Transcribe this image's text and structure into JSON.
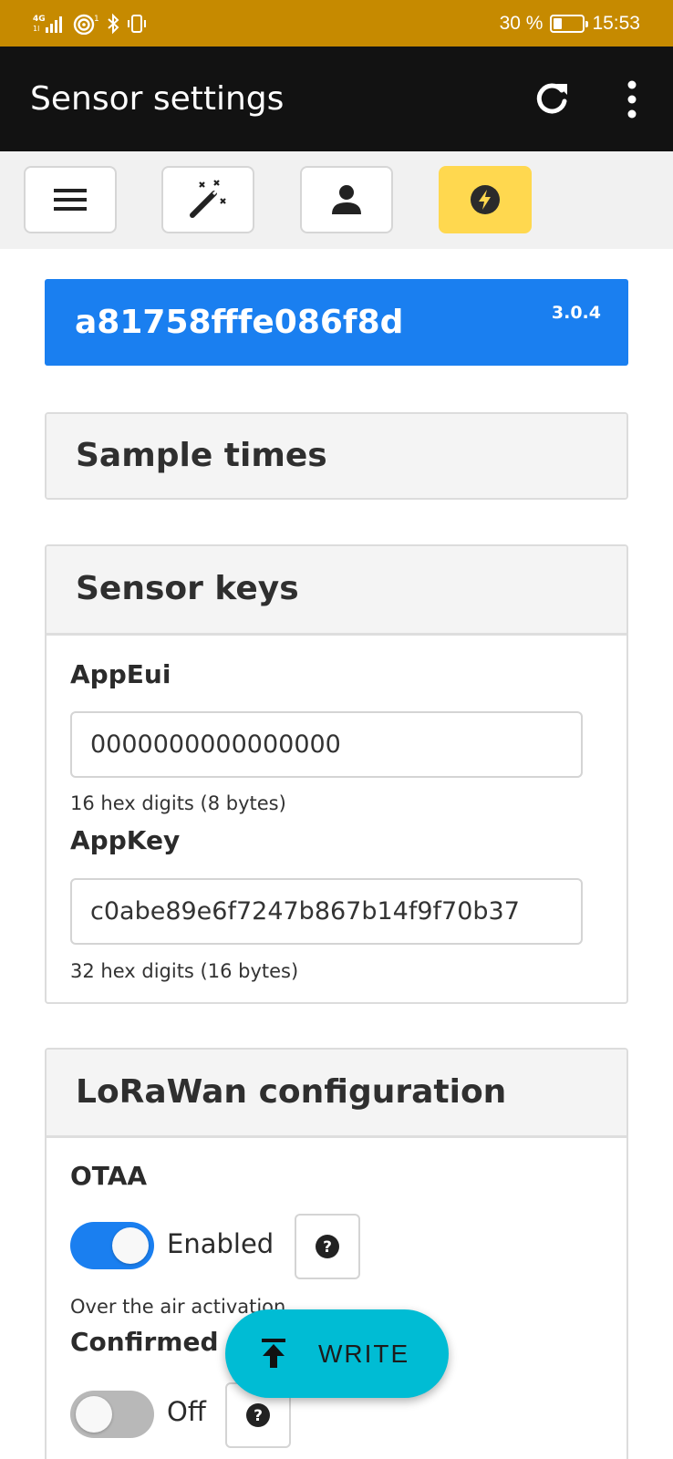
{
  "status_bar": {
    "network": "4G",
    "battery": "30 %",
    "battery_level": 0.3,
    "time": "15:53"
  },
  "app_bar": {
    "title": "Sensor settings",
    "refresh_icon": "refresh-icon",
    "more_icon": "more-vert-icon"
  },
  "toolbar": {
    "buttons": [
      {
        "icon": "menu-icon",
        "active": false
      },
      {
        "icon": "magic-wand-icon",
        "active": false
      },
      {
        "icon": "user-icon",
        "active": false
      },
      {
        "icon": "bolt-icon",
        "active": true
      }
    ]
  },
  "device": {
    "id": "a81758fffe086f8d",
    "version": "3.0.4"
  },
  "sample_times": {
    "title": "Sample times"
  },
  "sensor_keys": {
    "title": "Sensor keys",
    "app_eui": {
      "label": "AppEui",
      "value": "0000000000000000",
      "hint": "16 hex digits (8 bytes)"
    },
    "app_key": {
      "label": "AppKey",
      "value": "c0abe89e6f7247b867b14f9f70b37",
      "hint": "32 hex digits (16 bytes)"
    }
  },
  "lorawan": {
    "title": "LoRaWan configuration",
    "otaa": {
      "label": "OTAA",
      "state": "Enabled",
      "on": true,
      "hint": "Over the air activation"
    },
    "confirmed": {
      "label": "Confirmed",
      "state": "Off",
      "on": false
    }
  },
  "fab": {
    "label": "WRITE"
  },
  "colors": {
    "status_bar": "#c68a00",
    "app_bar": "#121212",
    "accent_blue": "#1a7ff0",
    "active_tab": "#ffd84f",
    "fab": "#00bcd4"
  }
}
